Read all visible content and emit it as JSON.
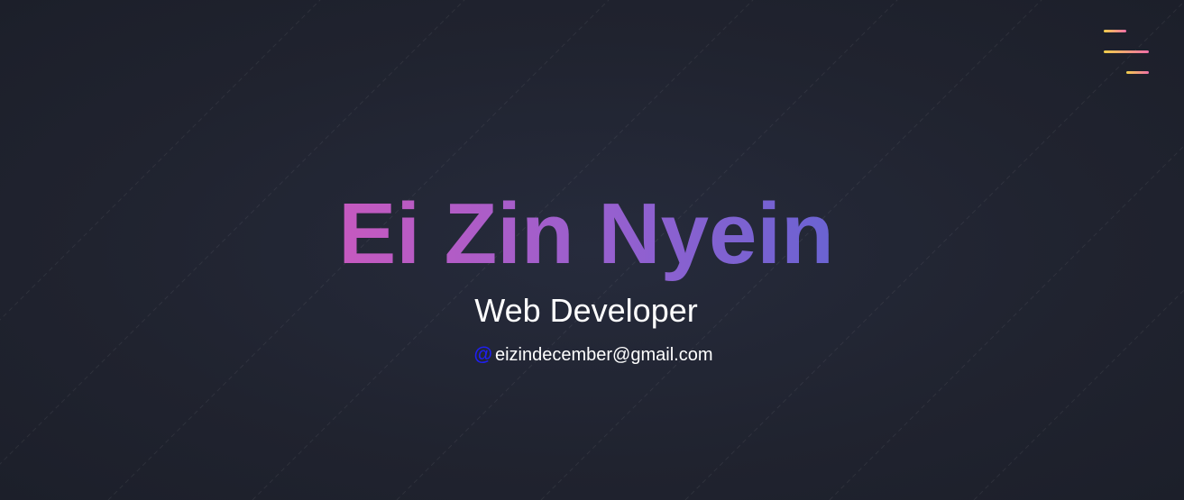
{
  "menu": {
    "icon": "hamburger-menu-icon",
    "colors": [
      "#f0cf4a",
      "#f06ea8"
    ]
  },
  "hero": {
    "name": "Ei Zin Nyein",
    "name_gradient": [
      "#c659bf",
      "#9660cf",
      "#6a63d2"
    ],
    "role": "Web Developer",
    "contact": {
      "icon": "at-icon",
      "icon_glyph": "@",
      "icon_color": "#1f1ff0",
      "email": "eizindecember@gmail.com"
    }
  },
  "background": {
    "color": "#20232f"
  }
}
